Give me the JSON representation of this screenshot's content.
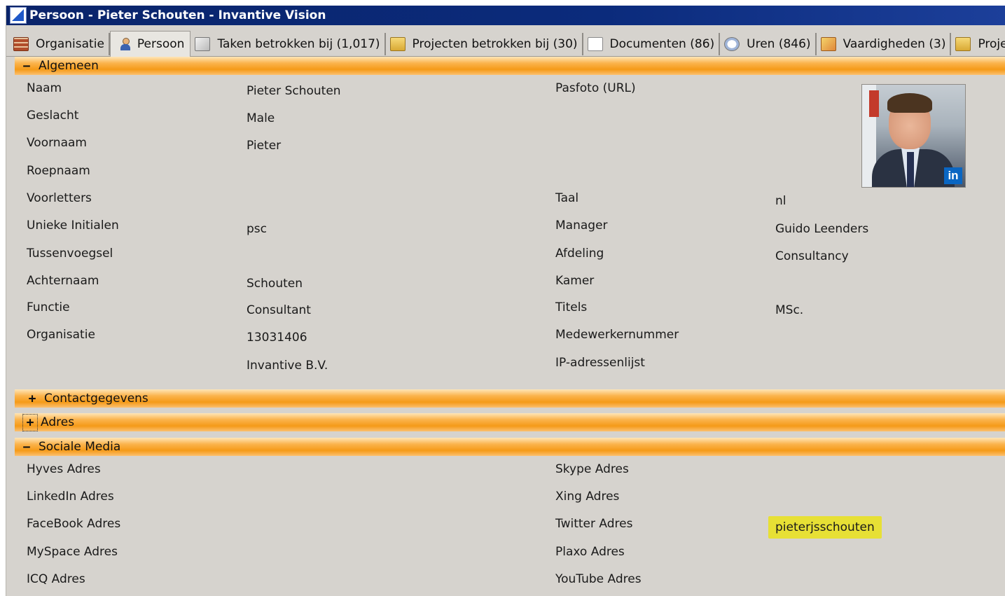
{
  "window": {
    "title": "Persoon - Pieter Schouten - Invantive Vision"
  },
  "tabs": [
    {
      "label": "Organisatie",
      "icon": "organisation-icon"
    },
    {
      "label": "Persoon",
      "icon": "person-icon"
    },
    {
      "label": "Taken betrokken bij (1,017)",
      "icon": "tasks-icon"
    },
    {
      "label": "Projecten betrokken bij (30)",
      "icon": "projects-icon"
    },
    {
      "label": "Documenten (86)",
      "icon": "documents-icon"
    },
    {
      "label": "Uren (846)",
      "icon": "clock-icon"
    },
    {
      "label": "Vaardigheden (3)",
      "icon": "skills-icon"
    },
    {
      "label": "Projectallocaties",
      "icon": "allocation-icon"
    }
  ],
  "sections": {
    "algemeen": {
      "label": "Algemeen",
      "toggle": "−"
    },
    "contact": {
      "label": "Contactgegevens",
      "toggle": "+"
    },
    "adres": {
      "label": "Adres",
      "toggle": "+"
    },
    "sociaal": {
      "label": "Sociale Media",
      "toggle": "−"
    }
  },
  "general": {
    "naam": {
      "label": "Naam",
      "value": "Pieter Schouten"
    },
    "geslacht": {
      "label": "Geslacht",
      "value": "Male"
    },
    "voornaam": {
      "label": "Voornaam",
      "value": "Pieter"
    },
    "roepnaam": {
      "label": "Roepnaam",
      "value": ""
    },
    "voorletters": {
      "label": "Voorletters",
      "value": ""
    },
    "initialen": {
      "label": "Unieke Initialen",
      "value": "psc"
    },
    "tussenvoegsel": {
      "label": "Tussenvoegsel",
      "value": ""
    },
    "achternaam": {
      "label": "Achternaam",
      "value": "Schouten"
    },
    "functie": {
      "label": "Functie",
      "value": "Consultant"
    },
    "organisatie": {
      "label": "Organisatie",
      "value": "13031406",
      "value2": "Invantive B.V."
    },
    "pasfoto": {
      "label": "Pasfoto (URL)"
    },
    "taal": {
      "label": "Taal",
      "value": "nl"
    },
    "manager": {
      "label": "Manager",
      "value": "Guido Leenders"
    },
    "afdeling": {
      "label": "Afdeling",
      "value": "Consultancy"
    },
    "kamer": {
      "label": "Kamer",
      "value": ""
    },
    "titels": {
      "label": "Titels",
      "value": "MSc."
    },
    "medewerkernummer": {
      "label": "Medewerkernummer",
      "value": ""
    },
    "ip": {
      "label": "IP-adressenlijst",
      "value": ""
    },
    "photo_badge": "in"
  },
  "social": {
    "hyves": {
      "label": "Hyves Adres",
      "value": ""
    },
    "linkedin": {
      "label": "LinkedIn Adres",
      "value": ""
    },
    "facebook": {
      "label": "FaceBook Adres",
      "value": ""
    },
    "myspace": {
      "label": "MySpace Adres",
      "value": ""
    },
    "icq": {
      "label": "ICQ Adres",
      "value": ""
    },
    "skype": {
      "label": "Skype Adres",
      "value": ""
    },
    "xing": {
      "label": "Xing Adres",
      "value": ""
    },
    "twitter": {
      "label": "Twitter Adres",
      "value": "pieterjsschouten"
    },
    "plaxo": {
      "label": "Plaxo Adres",
      "value": ""
    },
    "youtube": {
      "label": "YouTube Adres",
      "value": ""
    }
  },
  "colors": {
    "title_bar": "#0a246a",
    "section_bar": "#f59a18",
    "highlight": "#e7e035",
    "background": "#d6d3ce"
  }
}
